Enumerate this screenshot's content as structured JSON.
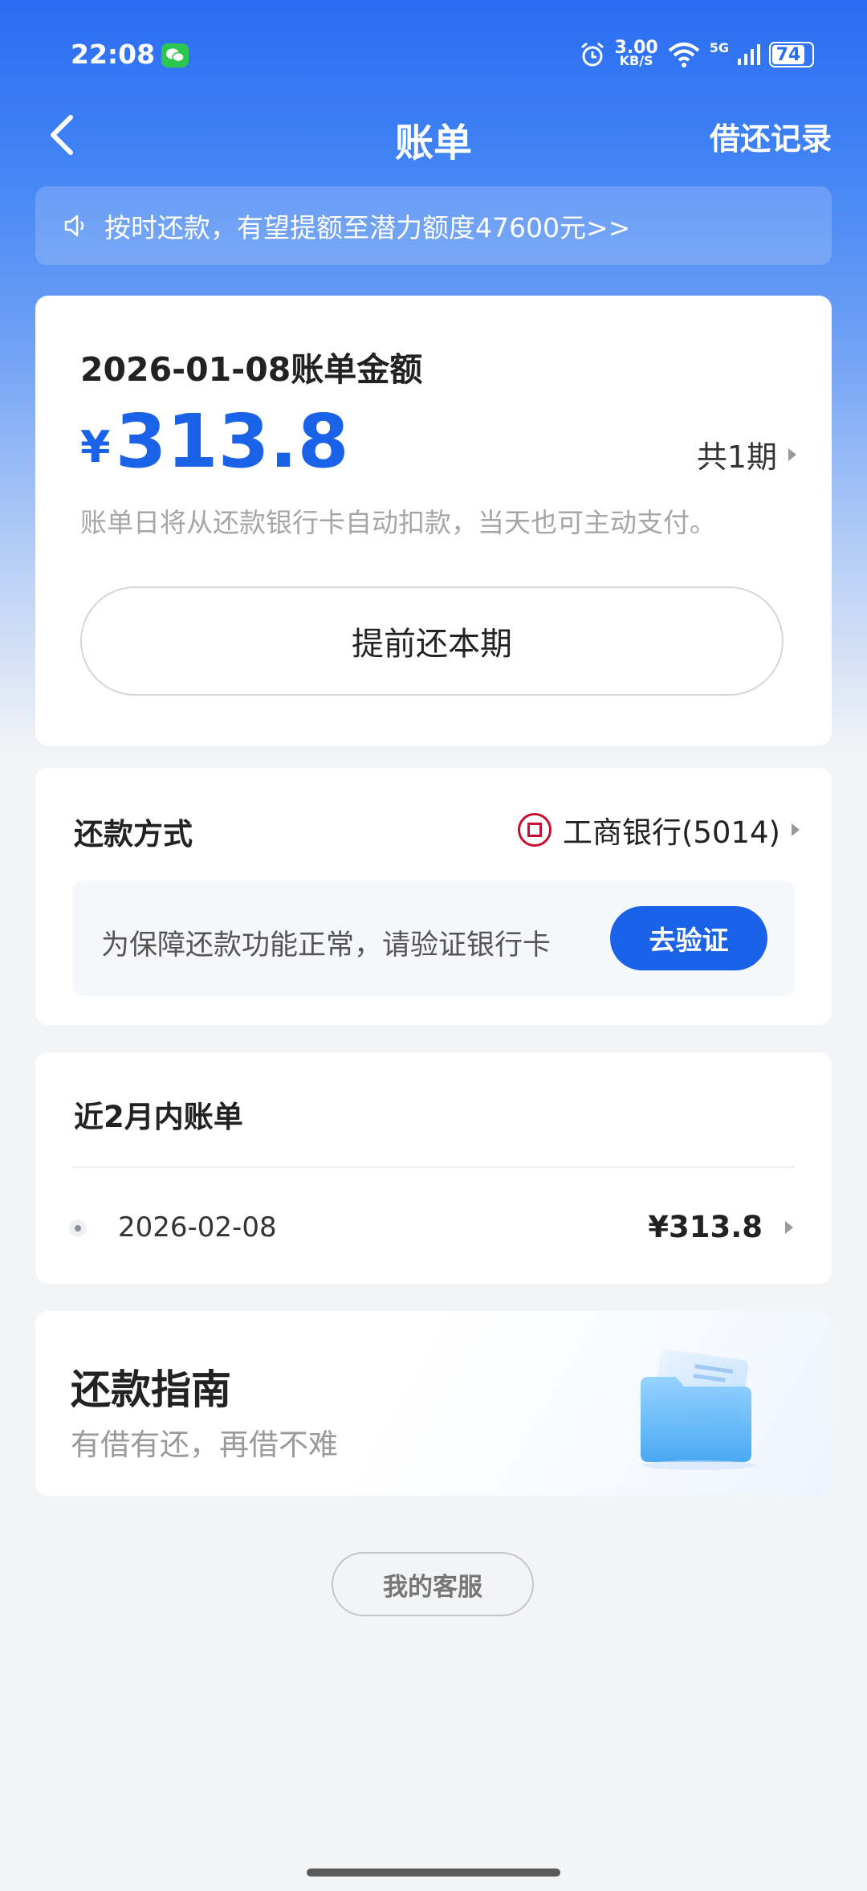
{
  "status_bar": {
    "time": "22:08",
    "net_speed_value": "3.00",
    "net_speed_unit": "KB/S",
    "network": "5G",
    "battery": "74"
  },
  "header": {
    "title": "账单",
    "right_link": "借还记录"
  },
  "notice": {
    "text": "按时还款，有望提额至潜力额度47600元>>"
  },
  "bill": {
    "title": "2026-01-08账单金额",
    "currency": "¥",
    "amount": "313.8",
    "periods": "共1期",
    "note": "账单日将从还款银行卡自动扣款，当天也可主动支付。",
    "prepay_label": "提前还本期"
  },
  "repayment_method": {
    "label": "还款方式",
    "bank": "工商银行(5014)",
    "verify_text": "为保障还款功能正常，请验证银行卡",
    "verify_button": "去验证"
  },
  "recent_bills": {
    "title": "近2月内账单",
    "items": [
      {
        "date": "2026-02-08",
        "amount": "¥313.8"
      }
    ]
  },
  "guide": {
    "title": "还款指南",
    "subtitle": "有借有还，再借不难"
  },
  "service_button": "我的客服",
  "colors": {
    "primary": "#1a62e8",
    "header_blue": "#2a6cf2",
    "bank_red": "#c8102e"
  }
}
